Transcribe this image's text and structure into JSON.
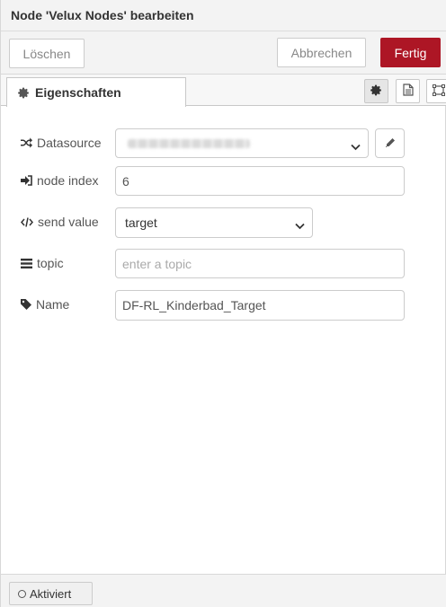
{
  "header": {
    "title": "Node 'Velux Nodes' bearbeiten"
  },
  "toolbar": {
    "delete_label": "Löschen",
    "cancel_label": "Abbrechen",
    "done_label": "Fertig"
  },
  "tabs": [
    {
      "label": "Eigenschaften",
      "icon": "gear-icon",
      "active": true
    }
  ],
  "tab_buttons": [
    {
      "icon": "gear-icon",
      "active": true
    },
    {
      "icon": "document-icon",
      "active": false
    },
    {
      "icon": "frame-icon",
      "active": false
    }
  ],
  "form": {
    "datasource": {
      "label": "Datasource",
      "icon": "shuffle-icon",
      "value_hidden": true
    },
    "node_index": {
      "label": "node index",
      "icon": "sign-in-icon",
      "value": "6"
    },
    "send_value": {
      "label": "send value",
      "icon": "code-icon",
      "value": "target"
    },
    "topic": {
      "label": "topic",
      "icon": "list-icon",
      "value": "",
      "placeholder": "enter a topic"
    },
    "name": {
      "label": "Name",
      "icon": "tag-icon",
      "value": "DF-RL_Kinderbad_Target"
    }
  },
  "footer": {
    "toggle_label": "Aktiviert"
  },
  "colors": {
    "primary": "#ad1625",
    "border": "#cccccc",
    "panel": "#f3f3f3"
  }
}
